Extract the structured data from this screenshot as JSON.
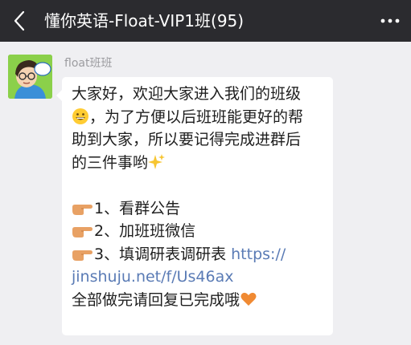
{
  "header": {
    "title": "懂你英语-Float-VIP1班(95)",
    "back_icon": "back-arrow-icon",
    "more_icon": "more-dots-icon",
    "background": "#2b2b2f"
  },
  "message": {
    "sender": "float班班",
    "avatar_icon": "cartoon-avatar-icon",
    "avatar_badge_text": "懂你英语 Float",
    "lines": {
      "l1": "大家好，欢迎大家进入我们的班级",
      "l2": "，为了方便以后班班能更好的帮",
      "l3": "助到大家，所以要记得完成进群后",
      "l4": "的三件事哟",
      "item1": "1、看群公告",
      "item2": "2、加班班微信",
      "item3": "3、填调研表调研表 ",
      "link_part1": "https://",
      "link_part2": "jinshuju.net/f/Us46ax",
      "closing": "全部做完请回复已完成哦"
    },
    "emojis": [
      "grinning-face-icon",
      "sparkles-icon",
      "pointing-hand-icon",
      "orange-heart-icon"
    ],
    "link_color": "#5a7bb5"
  }
}
